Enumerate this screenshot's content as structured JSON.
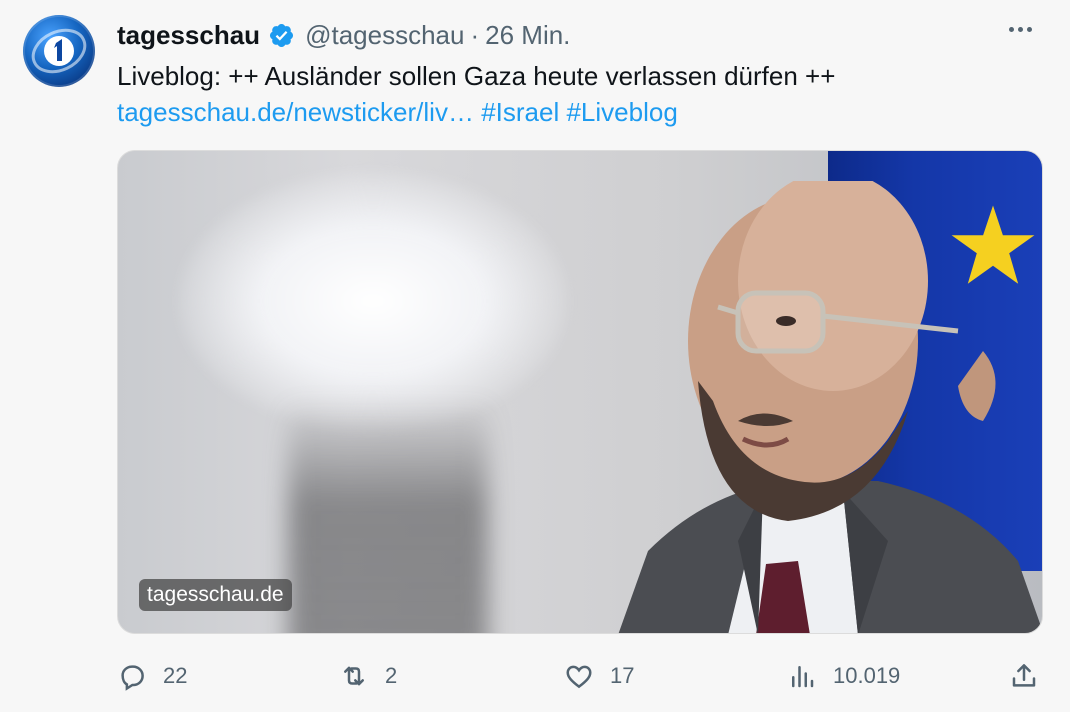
{
  "tweet": {
    "display_name": "tagesschau",
    "handle": "@tagesschau",
    "separator": "·",
    "time": "26 Min.",
    "text_main": "Liveblog: ++ Ausländer sollen Gaza heute verlassen dürfen ++",
    "link": "tagesschau.de/newsticker/liv…",
    "hashtags": [
      "#Israel",
      "#Liveblog"
    ],
    "media_watermark": "tagesschau.de"
  },
  "actions": {
    "replies": "22",
    "retweets": "2",
    "likes": "17",
    "views": "10.019"
  },
  "colors": {
    "link": "#1d9bf0",
    "verified": "#1d9bf0",
    "muted": "#536471",
    "background": "#f7f7f7"
  },
  "icons": [
    "tagesschau-logo-icon",
    "verified-badge-icon",
    "more-icon",
    "reply-icon",
    "retweet-icon",
    "like-icon",
    "views-icon",
    "share-icon"
  ]
}
